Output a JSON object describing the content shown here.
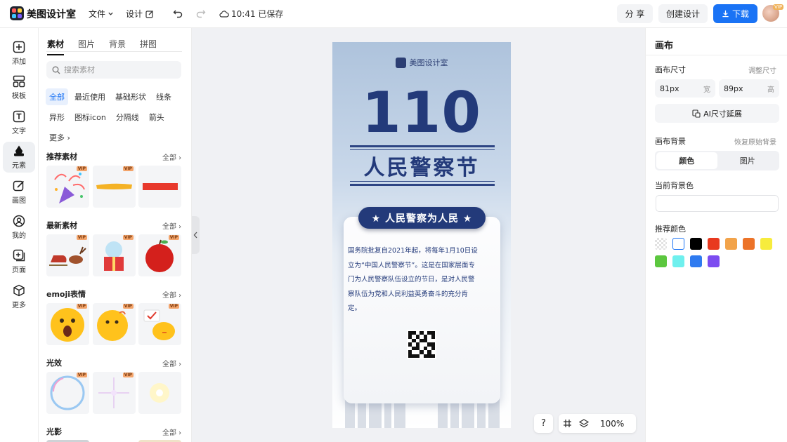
{
  "app": {
    "name": "美图设计室"
  },
  "toolbar": {
    "file_menu": "文件",
    "design_menu": "设计",
    "saved_status": "10:41 已保存",
    "share_label": "分 享",
    "create_label": "创建设计",
    "download_label": "下载",
    "vip_badge": "VIP"
  },
  "rail": {
    "items": [
      {
        "label": "添加"
      },
      {
        "label": "模板"
      },
      {
        "label": "文字"
      },
      {
        "label": "元素"
      },
      {
        "label": "画图"
      },
      {
        "label": "我的"
      },
      {
        "label": "页面"
      },
      {
        "label": "更多"
      }
    ]
  },
  "panel": {
    "tabs": [
      "素材",
      "图片",
      "背景",
      "拼图"
    ],
    "search_placeholder": "搜索素材",
    "chips": [
      "全部",
      "最近使用",
      "基础形状",
      "线条",
      "异形",
      "图标icon",
      "分隔线",
      "箭头",
      "更多"
    ],
    "see_all": "全部",
    "vip": "VIP",
    "sections": [
      {
        "title": "推荐素材"
      },
      {
        "title": "最新素材"
      },
      {
        "title": "emoji表情"
      },
      {
        "title": "光效"
      },
      {
        "title": "光影"
      }
    ]
  },
  "poster": {
    "brand": "美图设计室",
    "number": "110",
    "title": "人民警察节",
    "slogan": "★ 人民警察为人民 ★",
    "body": "国务院批复自2021年起，将每年1月10日设立为“中国人民警察节”。这是在国家层面专门为人民警察队伍设立的节日，是对人民警察队伍为党和人民利益英勇奋斗的充分肯定。"
  },
  "canvas_controls": {
    "help": "?",
    "zoom": "100%"
  },
  "props": {
    "header": "画布",
    "size_label": "画布尺寸",
    "resize_link": "调整尺寸",
    "width_value": "81px",
    "width_unit": "宽",
    "height_value": "89px",
    "height_unit": "高",
    "ai_extend": "AI尺寸延展",
    "bg_label": "画布背景",
    "restore_bg": "恢复原始背景",
    "seg_color": "颜色",
    "seg_image": "图片",
    "current_bg": "当前背景色",
    "recommended": "推荐颜色",
    "swatches": [
      "transparent",
      "#ffffff",
      "#000000",
      "#e8391f",
      "#f2a34a",
      "#ec7328",
      "#f7ec3d",
      "#5cc73f",
      "#6ff0ee",
      "#2f7bf0",
      "#7c4cf0"
    ]
  },
  "colors": {
    "accent": "#1a73f5",
    "poster_navy": "#233a7a"
  }
}
